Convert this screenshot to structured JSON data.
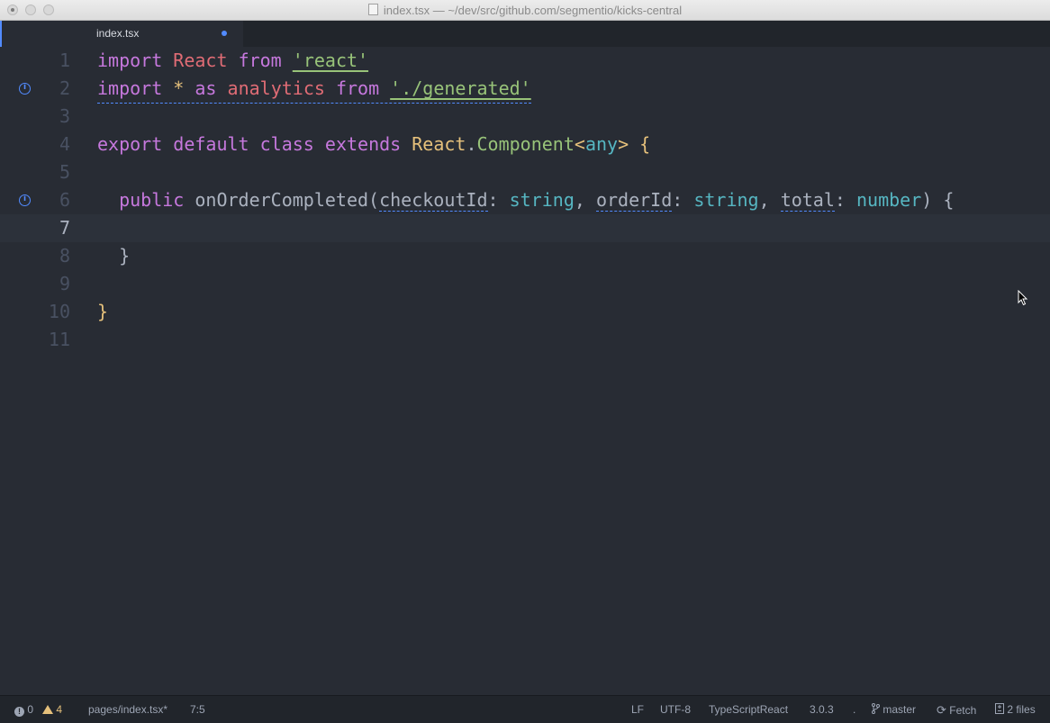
{
  "window": {
    "title": "index.tsx — ~/dev/src/github.com/segmentio/kicks-central"
  },
  "tab": {
    "label": "index.tsx"
  },
  "editor": {
    "line_numbers": [
      "1",
      "2",
      "3",
      "4",
      "5",
      "6",
      "7",
      "8",
      "9",
      "10",
      "11"
    ],
    "lines": {
      "l1": {
        "kw1": "import",
        "name": "React",
        "kw2": "from",
        "str": "'react'"
      },
      "l2": {
        "kw1": "import",
        "star": "*",
        "kw2": "as",
        "name": "analytics",
        "kw3": "from",
        "str": "'./generated'"
      },
      "l4": {
        "kw1": "export",
        "kw2": "default",
        "kw3": "class",
        "kw4": "extends",
        "obj": "React",
        "dot": ".",
        "cls": "Component",
        "lt": "<",
        "any": "any",
        "gt": ">",
        "brace": "{"
      },
      "l6": {
        "kw": "public",
        "fn": "onOrderCompleted",
        "p_open": "(",
        "p1": "checkoutId",
        "c1": ":",
        "t1": "string",
        "comma1": ",",
        "p2": "orderId",
        "c2": ":",
        "t2": "string",
        "comma2": ",",
        "p3": "total",
        "c3": ":",
        "t3": "number",
        "p_close": ")",
        "brace": "{"
      },
      "l8": {
        "brace": "}"
      },
      "l10": {
        "brace": "}"
      }
    },
    "current_line": 7
  },
  "statusbar": {
    "errors": "0",
    "warnings": "4",
    "file": "pages/index.tsx*",
    "cursor": "7:5",
    "line_ending": "LF",
    "encoding": "UTF-8",
    "grammar": "TypeScriptReact",
    "ts_version": "3.0.3",
    "dot": ".",
    "branch": "master",
    "fetch": "Fetch",
    "files": "2 files"
  },
  "colors": {
    "background": "#282c34",
    "keyword": "#c678dd",
    "variable": "#e06c75",
    "string": "#98c379",
    "type": "#56b6c2",
    "accent": "#528bff"
  }
}
